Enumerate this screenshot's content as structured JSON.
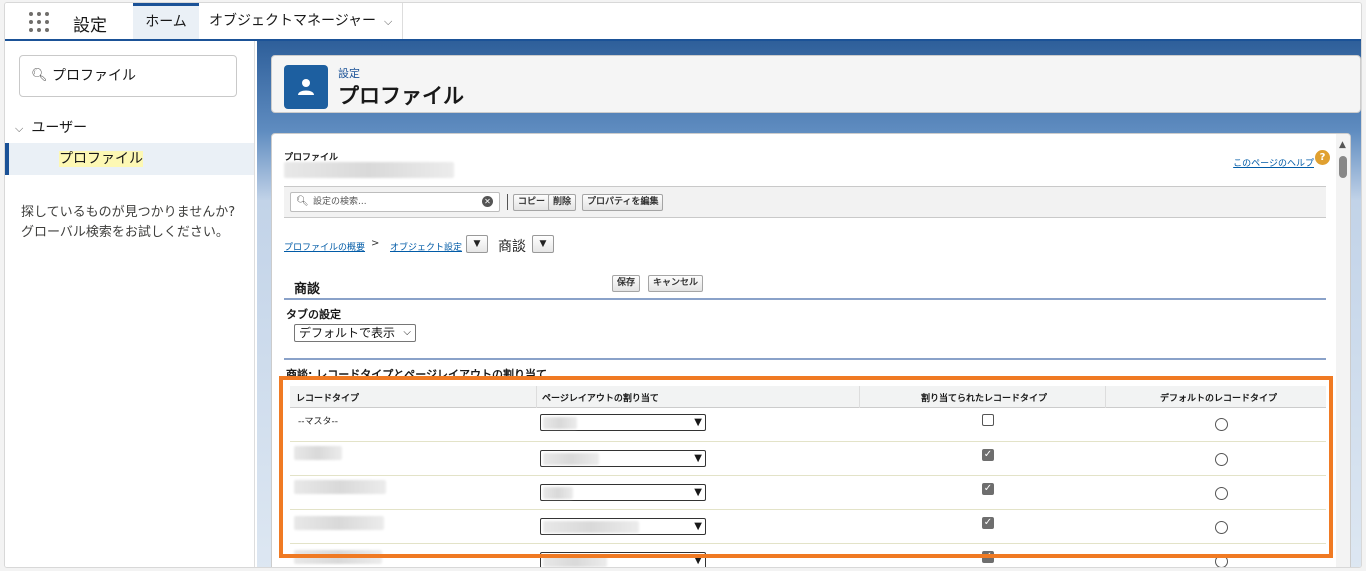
{
  "topnav": {
    "app_name": "設定",
    "tab_home": "ホーム",
    "tab_object_manager": "オブジェクトマネージャー"
  },
  "sidebar": {
    "quickfind_value": "プロファイル",
    "group_users": "ユーザー",
    "item_profile": "プロファイル",
    "not_found_text": "探しているものが見つかりませんか? グローバル検索をお試しください。"
  },
  "header": {
    "subtitle": "設定",
    "title": "プロファイル"
  },
  "page": {
    "type_label": "プロファイル",
    "help_link": "このページのヘルプ",
    "help_icon": "?",
    "search_placeholder": "設定の検索...",
    "buttons": {
      "copy": "コピー",
      "delete": "削除",
      "edit_properties": "プロパティを編集"
    },
    "breadcrumb": {
      "overview": "プロファイルの概要",
      "separator": ">",
      "object_settings": "オブジェクト設定",
      "current": "商談"
    },
    "section_title": "商談",
    "save": "保存",
    "cancel": "キャンセル",
    "tab_settings_label": "タブの設定",
    "tab_settings_value": "デフォルトで表示",
    "record_types_title": "商談: レコードタイプとページレイアウトの割り当て"
  },
  "grid": {
    "headers": [
      "レコードタイプ",
      "ページレイアウトの割り当て",
      "割り当てられたレコードタイプ",
      "デフォルトのレコードタイプ"
    ],
    "rows": [
      {
        "record_type": "--マスタ--",
        "assigned": false,
        "default": false
      },
      {
        "record_type": "",
        "assigned": true,
        "default": false
      },
      {
        "record_type": "",
        "assigned": true,
        "default": false
      },
      {
        "record_type": "",
        "assigned": true,
        "default": false
      },
      {
        "record_type": "",
        "assigned": true,
        "default": false
      }
    ]
  },
  "colors": {
    "brand": "#1b5297",
    "highlight": "#f07a23",
    "link": "#015ba7"
  },
  "icons": [
    "app-launcher-icon",
    "search-icon",
    "chevron-down-icon",
    "user-icon",
    "help-icon",
    "clear-icon"
  ]
}
